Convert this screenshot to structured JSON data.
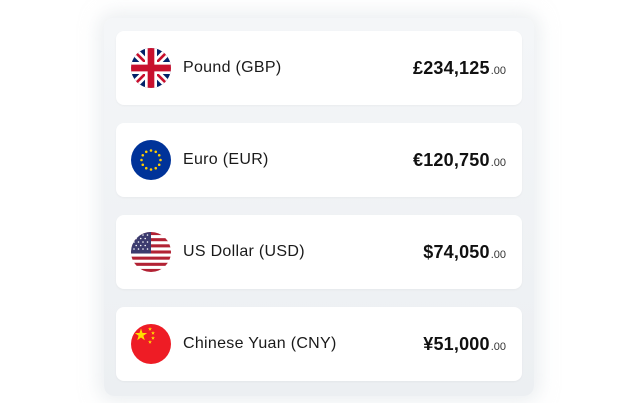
{
  "currencies": [
    {
      "name": "Pound (GBP)",
      "amount": "£234,125",
      "cents": ".00",
      "flag": "uk-flag-icon"
    },
    {
      "name": "Euro (EUR)",
      "amount": "€120,750",
      "cents": ".00",
      "flag": "eu-flag-icon"
    },
    {
      "name": "US Dollar (USD)",
      "amount": "$74,050",
      "cents": ".00",
      "flag": "us-flag-icon"
    },
    {
      "name": "Chinese Yuan (CNY)",
      "amount": "¥51,000",
      "cents": ".00",
      "flag": "cn-flag-icon"
    }
  ],
  "colors": {
    "uk_blue": "#012169",
    "uk_red": "#C8102E",
    "eu_blue": "#003399",
    "eu_star": "#FFCC00",
    "us_red": "#B22234",
    "us_blue": "#3C3B6E",
    "cn_red": "#EE1C25",
    "cn_star": "#FFDE00"
  }
}
